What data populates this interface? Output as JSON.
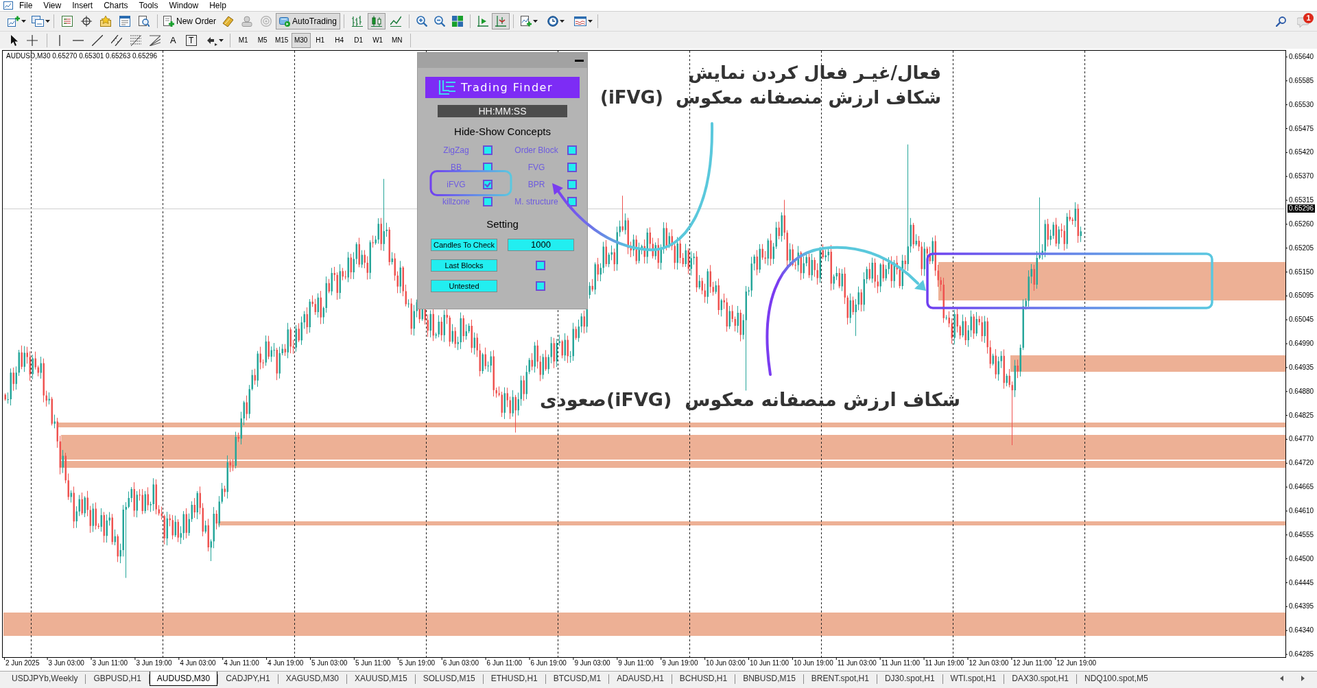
{
  "menu_bar": {
    "items": [
      "File",
      "View",
      "Insert",
      "Charts",
      "Tools",
      "Window",
      "Help"
    ]
  },
  "toolbar": {
    "new_order": "New Order",
    "auto_trading": {
      "label": "AutoTrading",
      "on": true
    },
    "chart_types": [
      {
        "selected": false
      },
      {
        "selected": true
      },
      {
        "selected": false
      }
    ],
    "auto_scroll": {
      "on": true
    },
    "notification_badge": "1"
  },
  "drawing_toolbar": {
    "text_tool": "A",
    "text_label_tool": "T",
    "timeframes": [
      {
        "label": "M1",
        "selected": false
      },
      {
        "label": "M5",
        "selected": false
      },
      {
        "label": "M15",
        "selected": false
      },
      {
        "label": "M30",
        "selected": true
      },
      {
        "label": "H1",
        "selected": false
      },
      {
        "label": "H4",
        "selected": false
      },
      {
        "label": "D1",
        "selected": false
      },
      {
        "label": "W1",
        "selected": false
      },
      {
        "label": "MN",
        "selected": false
      }
    ]
  },
  "chart": {
    "title": "AUDUSD,M30 0.65270 0.65301 0.65263 0.65296",
    "price_labels": [
      "0.65640",
      "0.65585",
      "0.65530",
      "0.65475",
      "0.65420",
      "0.65370",
      "0.65315",
      "0.65260",
      "0.65205",
      "0.65150",
      "0.65095",
      "0.65045",
      "0.64990",
      "0.64935",
      "0.64880",
      "0.64825",
      "0.64770",
      "0.64720",
      "0.64665",
      "0.64610",
      "0.64555",
      "0.64500",
      "0.64445",
      "0.64395",
      "0.64340",
      "0.64285"
    ],
    "current_price": "0.65296",
    "time_labels": [
      "2 Jun 2025",
      "3 Jun 03:00",
      "3 Jun 11:00",
      "3 Jun 19:00",
      "4 Jun 03:00",
      "4 Jun 11:00",
      "4 Jun 19:00",
      "5 Jun 03:00",
      "5 Jun 11:00",
      "5 Jun 19:00",
      "6 Jun 03:00",
      "6 Jun 11:00",
      "6 Jun 19:00",
      "9 Jun 03:00",
      "9 Jun 11:00",
      "9 Jun 19:00",
      "10 Jun 03:00",
      "10 Jun 11:00",
      "10 Jun 19:00",
      "11 Jun 03:00",
      "11 Jun 11:00",
      "11 Jun 19:00",
      "12 Jun 03:00",
      "12 Jun 11:00",
      "12 Jun 19:00"
    ]
  },
  "panel": {
    "logo": "Trading Finder",
    "clock": "HH:MM:SS",
    "concepts_title": "Hide-Show Concepts",
    "concepts": [
      {
        "label": "ZigZag",
        "checked": false
      },
      {
        "label": "Order Block",
        "checked": false
      },
      {
        "label": "BB",
        "checked": false
      },
      {
        "label": "FVG",
        "checked": false
      },
      {
        "label": "iFVG",
        "checked": true
      },
      {
        "label": "BPR",
        "checked": false
      },
      {
        "label": "killzone",
        "checked": false
      },
      {
        "label": "M. structure",
        "checked": false
      }
    ],
    "settings_title": "Setting",
    "settings": [
      {
        "kind": "input",
        "label": "Candles To Check",
        "value": "1000"
      },
      {
        "kind": "checkbox",
        "label": "Last Blocks",
        "checked": false
      },
      {
        "kind": "checkbox",
        "label": "Untested",
        "checked": false
      }
    ]
  },
  "annotations": [
    {
      "text": "فعال/غیـر فعال کردن نمایش\nشکاف ارزش منصفانه معکوس  (iFVG)"
    },
    {
      "text": "شکاف ارزش منصفانه معکوس  (iFVG)صعودی"
    }
  ],
  "symbol_tabs": [
    {
      "label": "USDJPYb,Weekly",
      "selected": false
    },
    {
      "label": "GBPUSD,H1",
      "selected": false
    },
    {
      "label": "AUDUSD,M30",
      "selected": true
    },
    {
      "label": "CADJPY,H1",
      "selected": false
    },
    {
      "label": "XAGUSD,M30",
      "selected": false
    },
    {
      "label": "XAUUSD,M15",
      "selected": false
    },
    {
      "label": "SOLUSD,M15",
      "selected": false
    },
    {
      "label": "ETHUSD,H1",
      "selected": false
    },
    {
      "label": "BTCUSD,M1",
      "selected": false
    },
    {
      "label": "ADAUSD,H1",
      "selected": false
    },
    {
      "label": "BCHUSD,H1",
      "selected": false
    },
    {
      "label": "BNBUSD,M15",
      "selected": false
    },
    {
      "label": "BRENT.spot,H1",
      "selected": false
    },
    {
      "label": "DJ30.spot,H1",
      "selected": false
    },
    {
      "label": "WTI.spot,H1",
      "selected": false
    },
    {
      "label": "DAX30.spot,H1",
      "selected": false
    },
    {
      "label": "NDQ100.spot,M5",
      "selected": false
    }
  ]
}
